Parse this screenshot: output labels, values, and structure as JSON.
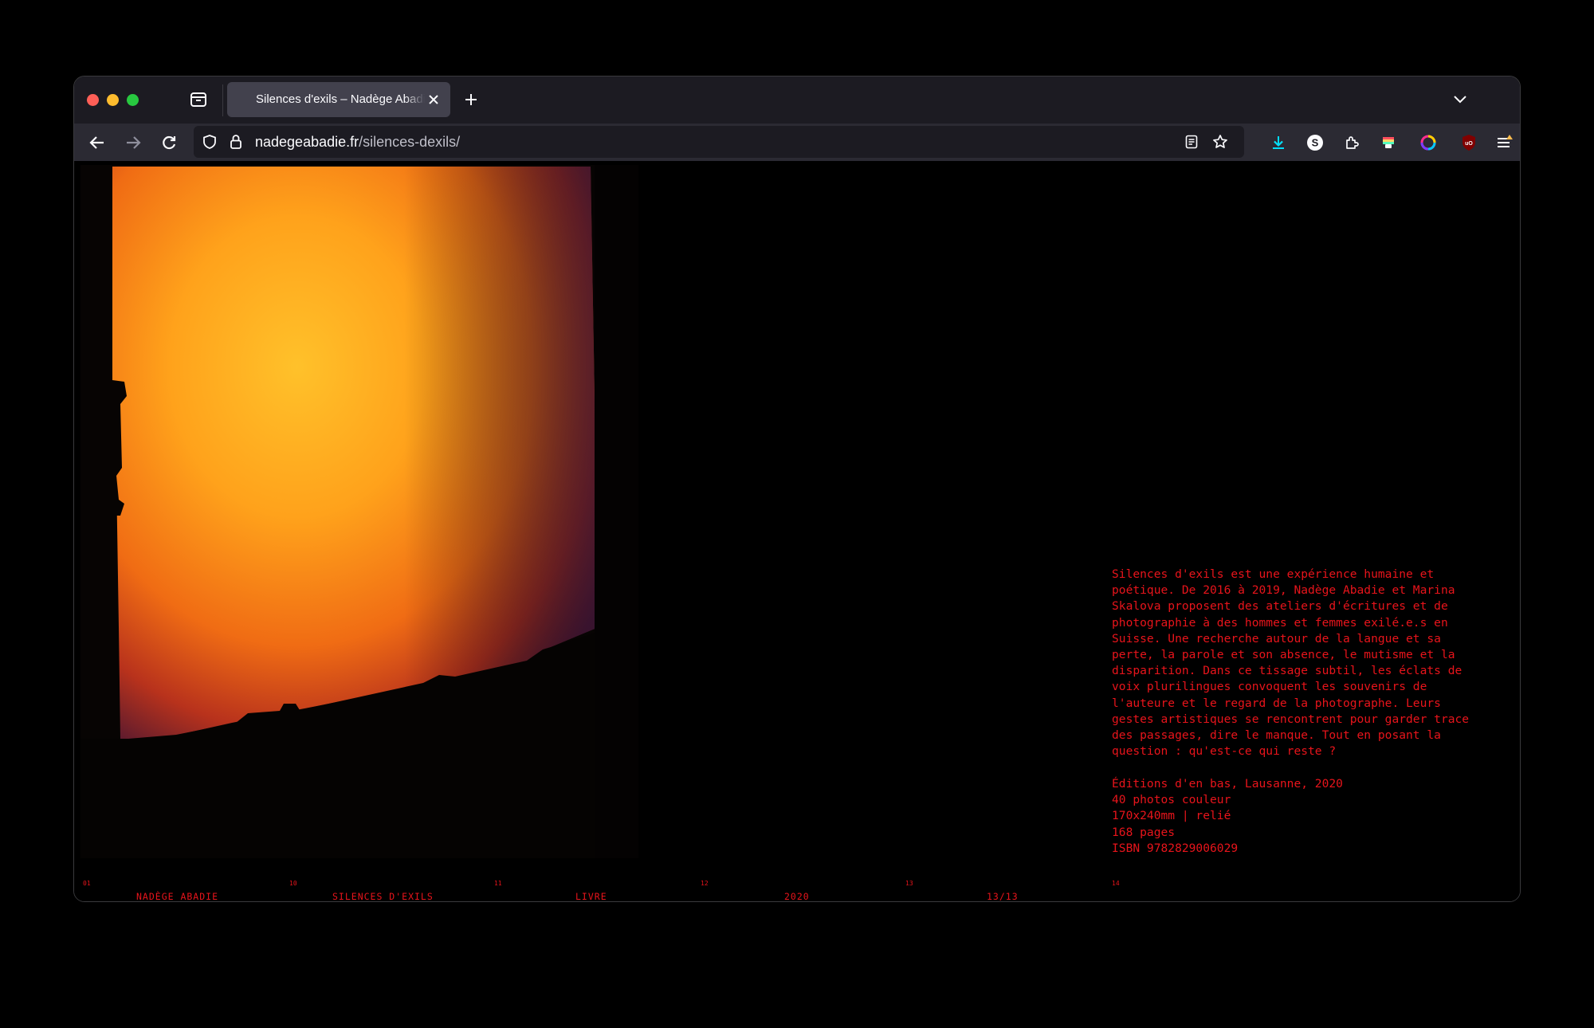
{
  "browser": {
    "tab_title": "Silences d'exils – Nadège Abadie",
    "url_domain": "nadegeabadie.fr",
    "url_path": "/silences-dexils/",
    "accent_color": "#e8141b"
  },
  "page": {
    "description": "Silences d'exils est une expérience humaine et\npoétique. De 2016 à 2019, Nadège Abadie et Marina\nSkalova proposent des ateliers d'écritures et de\nphotographie à des hommes et femmes exilé.e.s en\nSuisse. Une recherche autour de la langue et sa\nperte, la parole et son absence, le mutisme et la\ndisparition. Dans ce tissage subtil, les éclats de\nvoix plurilingues convoquent les souvenirs de\nl'auteure et le regard de la photographe. Leurs\ngestes artistiques se rencontrent pour garder trace\ndes passages, dire le manque. Tout en posant la\nquestion : qu'est-ce qui reste ?",
    "publication": {
      "publisher": "Éditions d'en bas, Lausanne, 2020",
      "photos": "40 photos couleur",
      "format": "170x240mm | relié",
      "pages": "168 pages",
      "isbn": "ISBN 9782829006029"
    },
    "footer": [
      {
        "num": "01",
        "label": "NADÈGE ABADIE"
      },
      {
        "num": "10",
        "label": "SILENCES D'EXILS"
      },
      {
        "num": "11",
        "label": "LIVRE"
      },
      {
        "num": "12",
        "label": "2020"
      },
      {
        "num": "13",
        "label": "13/13"
      },
      {
        "num": "14",
        "label": ""
      }
    ]
  }
}
